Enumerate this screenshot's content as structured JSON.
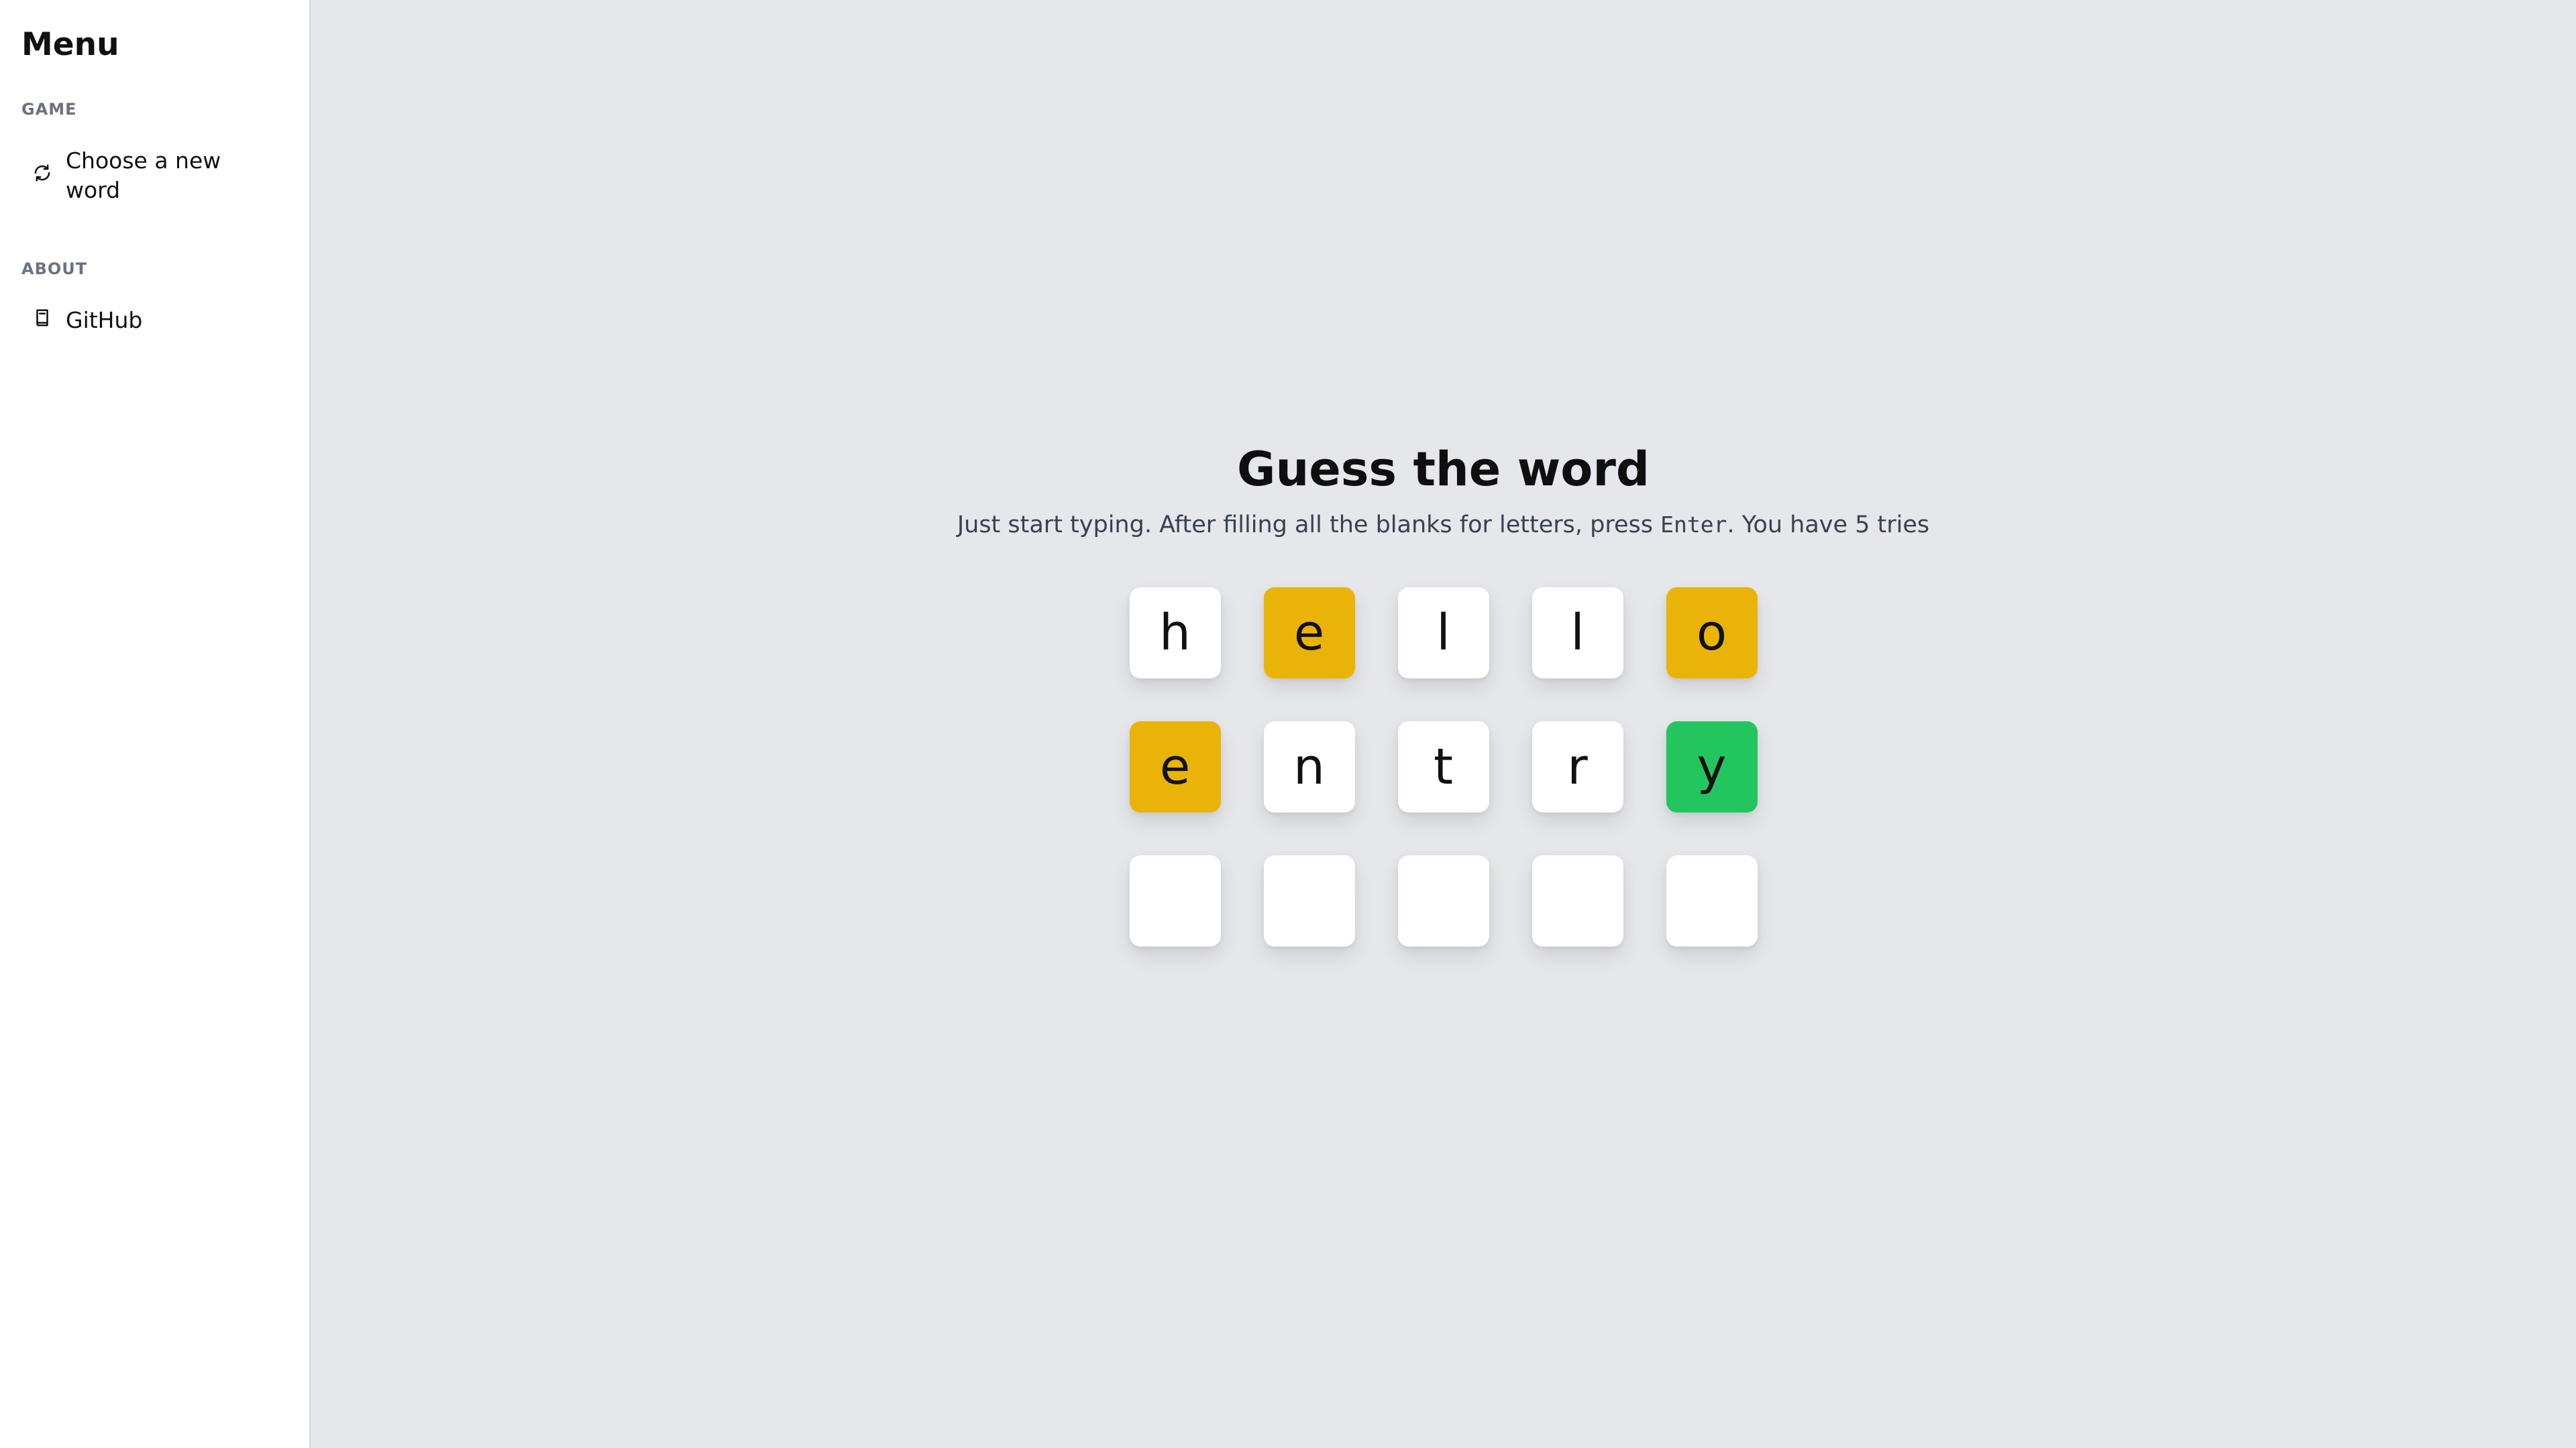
{
  "sidebar": {
    "title": "Menu",
    "sections": [
      {
        "label": "GAME",
        "items": [
          {
            "label": "Choose a new word",
            "icon": "refresh-icon"
          }
        ]
      },
      {
        "label": "ABOUT",
        "items": [
          {
            "label": "GitHub",
            "icon": "book-icon"
          }
        ]
      }
    ]
  },
  "main": {
    "title": "Guess the word",
    "subtitle_before": "Just start typing. After filling all the blanks for letters, press ",
    "subtitle_key": "Enter",
    "subtitle_after": ". You have 5 tries"
  },
  "colors": {
    "present": "#eab308",
    "correct": "#22c55e",
    "empty": "#ffffff",
    "background": "#e5e7eb"
  },
  "board": [
    [
      {
        "letter": "h",
        "state": "absent"
      },
      {
        "letter": "e",
        "state": "present"
      },
      {
        "letter": "l",
        "state": "absent"
      },
      {
        "letter": "l",
        "state": "absent"
      },
      {
        "letter": "o",
        "state": "present"
      }
    ],
    [
      {
        "letter": "e",
        "state": "present"
      },
      {
        "letter": "n",
        "state": "absent"
      },
      {
        "letter": "t",
        "state": "absent"
      },
      {
        "letter": "r",
        "state": "absent"
      },
      {
        "letter": "y",
        "state": "correct"
      }
    ],
    [
      {
        "letter": "",
        "state": "empty"
      },
      {
        "letter": "",
        "state": "empty"
      },
      {
        "letter": "",
        "state": "empty"
      },
      {
        "letter": "",
        "state": "empty"
      },
      {
        "letter": "",
        "state": "empty"
      }
    ]
  ]
}
